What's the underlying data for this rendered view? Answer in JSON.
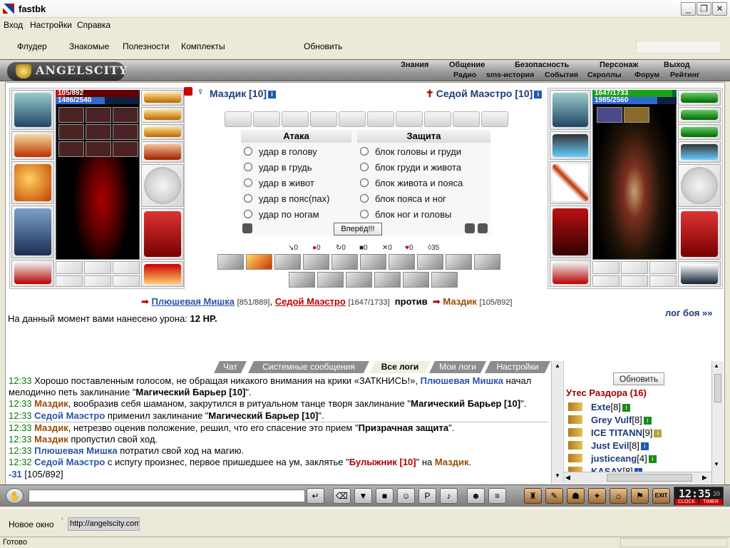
{
  "window": {
    "title": "fastbk",
    "minimize": "_",
    "maximize": "❐",
    "close": "✕"
  },
  "menu": {
    "items": [
      "Вход",
      "Настройки",
      "Справка"
    ]
  },
  "toolbar": {
    "items": [
      "Флудер",
      "Знакомые",
      "Полезности",
      "Комплекты"
    ],
    "refresh": "Обновить"
  },
  "game_nav": {
    "logo": "ANGELSCITY",
    "top": [
      "Знания",
      "Общение",
      "Безопасность",
      "Персонаж",
      "Выход"
    ],
    "bottom": [
      "Радио",
      "sms-история",
      "События",
      "Скроллы",
      "Форум",
      "Рейтинг"
    ]
  },
  "player_left": {
    "name": "Маздик [10]",
    "hp": "105/892",
    "mp": "1486/2540",
    "hp_fraction": 0.118,
    "mp_fraction": 0.585,
    "hp_color": "#c81010"
  },
  "player_right": {
    "name": "Седой Маэстро [10]",
    "hp": "1647/1733",
    "mp": "1985/2560",
    "hp_fraction": 0.95,
    "mp_fraction": 0.775,
    "hp_color": "#1aa01a"
  },
  "combat": {
    "attack_header": "Атака",
    "defense_header": "Защита",
    "attacks": [
      "удар в голову",
      "удар в грудь",
      "удар в живот",
      "удар в пояс(пах)",
      "удар по ногам"
    ],
    "defenses": [
      "блок головы и груди",
      "блок груди и живота",
      "блок живота и пояса",
      "блок пояса и ног",
      "блок ног и головы"
    ],
    "go_button": "Вперёд!!!",
    "counters": [
      "0",
      "0",
      "0",
      "0",
      "0",
      "0",
      "35"
    ]
  },
  "versus": {
    "team1": [
      {
        "name": "Плюшевая Мишка",
        "hp": "[851/889]",
        "color": "#2a55aa"
      },
      {
        "name": "Седой Маэстро",
        "hp": "[1647/1733]",
        "color": "#c00000"
      }
    ],
    "sep": ", ",
    "against": "против",
    "team2": [
      {
        "name": "Маздик",
        "hp": "[105/892]",
        "color": "#9a4a00"
      }
    ]
  },
  "damage": {
    "text": "На данный момент вами нанесено урона:",
    "value": "12 HP."
  },
  "battle_log_link": "лог боя »»",
  "chat_tabs": [
    "Чат",
    "Системные сообщения",
    "Все логи",
    "Мои логи",
    "Настройки"
  ],
  "chat_active_tab": 2,
  "chat_lines": [
    [
      {
        "t": "12:33 ",
        "c": "time"
      },
      {
        "t": "Хорошо поставленным голосом, не обращая никакого внимания на крики «ЗАТКНИСЬ!», "
      },
      {
        "t": "Плюшевая Мишка",
        "c": "nmb"
      },
      {
        "t": " начал мелодично петь заклинание \""
      },
      {
        "t": "Магический Барьер [10]",
        "c": "b"
      },
      {
        "t": "\"."
      }
    ],
    [
      {
        "t": "12:33 ",
        "c": "time"
      },
      {
        "t": "Маздик",
        "c": "nmr"
      },
      {
        "t": ", вообразив себя шаманом, закрутился в ритуальном танце творя заклинание \""
      },
      {
        "t": "Магический Барьер [10]",
        "c": "b"
      },
      {
        "t": "\"."
      }
    ],
    [
      {
        "t": "12:33 ",
        "c": "time"
      },
      {
        "t": "Седой Маэстро",
        "c": "nmb"
      },
      {
        "t": " применил заклинание \""
      },
      {
        "t": "Магический Барьер [10]",
        "c": "b"
      },
      {
        "t": "\"."
      }
    ],
    [
      {
        "t": "12:33 ",
        "c": "time"
      },
      {
        "t": "Маздик",
        "c": "nmr"
      },
      {
        "t": ", нетрезво оценив положение, решил, что его спасение это прием \""
      },
      {
        "t": "Призрачная защита",
        "c": "b"
      },
      {
        "t": "\"."
      }
    ],
    [
      {
        "t": "12:33 ",
        "c": "time"
      },
      {
        "t": "Маздик",
        "c": "nmr"
      },
      {
        "t": " пропустил свой ход."
      }
    ],
    [
      {
        "t": "12:33 ",
        "c": "time"
      },
      {
        "t": "Плюшевая Мишка",
        "c": "nmb"
      },
      {
        "t": " потратил свой ход на магию."
      }
    ],
    [
      {
        "t": "12:32 ",
        "c": "time"
      },
      {
        "t": "Седой Маэстро",
        "c": "nmb"
      },
      {
        "t": " с испугу произнес, первое пришедшее на ум, заклятье \""
      },
      {
        "t": "Булыжник [10]",
        "c": "red"
      },
      {
        "t": "\" на "
      },
      {
        "t": "Маздик",
        "c": "nmr"
      },
      {
        "t": "."
      }
    ],
    [
      {
        "t": "-31",
        "c": "nmb"
      },
      {
        "t": " [105/892]"
      }
    ]
  ],
  "right_panel": {
    "refresh": "Обновить",
    "location": "Утес Раздора (16)",
    "users": [
      {
        "name": "Exte",
        "level": "[8]"
      },
      {
        "name": "Grey Vulf",
        "level": "[8]"
      },
      {
        "name": "ICE TITANN",
        "level": "[9]"
      },
      {
        "name": "Just Evil",
        "level": "[8]"
      },
      {
        "name": "justiceang",
        "level": "[4]"
      },
      {
        "name": "KASAY",
        "level": "[8]"
      }
    ]
  },
  "bottom": {
    "exit": "EXIT",
    "clock_time": "12:35",
    "clock_sec": "39",
    "clock_label": "CLOCK",
    "timer_label": "TIMER"
  },
  "address": {
    "new_window": "Новое окно",
    "url": "http://angelscity.com"
  },
  "status": "Готово"
}
